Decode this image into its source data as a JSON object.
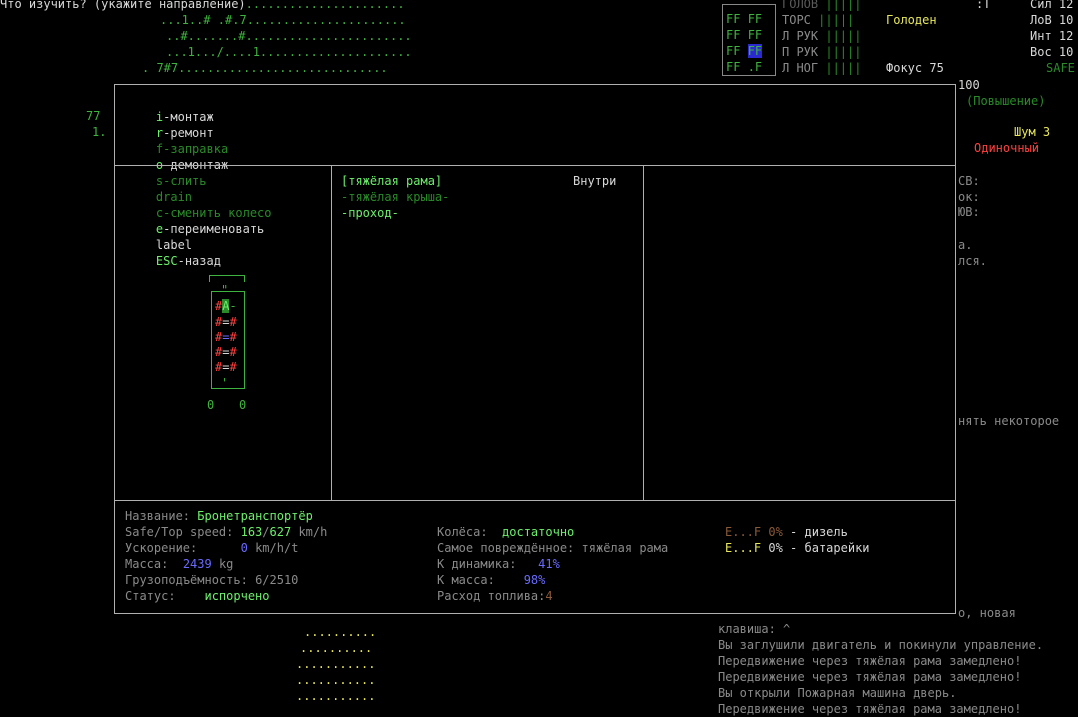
{
  "top_prompt": "Что изучить? (укажите направление)",
  "top_prompt_dots": "......................",
  "map_rows": [
    "...1..# .#.7......................",
    "..#.......#.......................",
    "...1.../....1.....................",
    ". 7#7............................."
  ],
  "left_numbers": [
    "77",
    "1."
  ],
  "body_status": {
    "parts": [
      {
        "label": "ГОЛОВ",
        "bar": "|||||"
      },
      {
        "label": "ТОРС",
        "bar": "|||||"
      },
      {
        "label": "Л РУК",
        "bar": "|||||"
      },
      {
        "label": "П РУК",
        "bar": "|||||"
      },
      {
        "label": "Л НОГ",
        "bar": "|||||"
      }
    ],
    "ff_cells": [
      [
        "FF",
        "FF"
      ],
      [
        "FF",
        "FF"
      ],
      [
        "FF",
        "FF"
      ],
      [
        "FF",
        ".F"
      ]
    ],
    "hunger": "Голоден",
    "focus_label": "Фокус",
    "focus_value": "75",
    "colon_t": ":T"
  },
  "stats": [
    {
      "label": "Сил",
      "value": "12"
    },
    {
      "label": "ЛоВ",
      "value": "10"
    },
    {
      "label": "Инт",
      "value": "12"
    },
    {
      "label": "Вос",
      "value": "10"
    }
  ],
  "safe_label": "SAFE",
  "right_panel": {
    "level": "100",
    "raise": "(Повышение)",
    "noise": "Шум 3",
    "mode": "Одиночный",
    "dirs": [
      "СВ:",
      "ок:",
      "ЮВ:"
    ],
    "frag1": "а.",
    "frag2": "лся.",
    "frag3": "нять некоторое",
    "frag4": "о, новая"
  },
  "commands": [
    {
      "key": "i",
      "text": "-монтаж"
    },
    {
      "key": "r",
      "text": "-ремонт"
    },
    {
      "key": "f",
      "text": "-заправка",
      "dim": true
    },
    {
      "key": "o",
      "text": "-демонтаж"
    },
    {
      "key": "s",
      "text": "-слить",
      "dim": true
    },
    {
      "key": "",
      "text": "drain",
      "dim": true
    },
    {
      "key": "c",
      "text": "-сменить колесо",
      "dim": true
    },
    {
      "key": "e",
      "text": "-переименовать"
    },
    {
      "key": "",
      "text": "label"
    },
    {
      "key": "ESC",
      "text": "-назад"
    }
  ],
  "parts_list": {
    "header": "[тяжёлая рама]",
    "location": "Внутри",
    "items": [
      "-тяжёлая крыша-",
      "-проход-"
    ]
  },
  "vehicle_counts": [
    "0",
    "0"
  ],
  "info": {
    "name_label": "Название:",
    "name_value": "Бронетранспортёр",
    "speed_label": "Safe/Top speed:",
    "speed_safe": "163",
    "speed_top": "627",
    "speed_unit": "km/h",
    "accel_label": "Ускорение:",
    "accel_value": "0",
    "accel_unit": "km/h/t",
    "mass_label": "Масса:",
    "mass_value": "2439",
    "mass_unit": "kg",
    "cargo_label": "Грузоподъёмность:",
    "cargo_value": "6/2510",
    "status_label": "Статус:",
    "status_value": "испорчено",
    "wheels_label": "Колёса:",
    "wheels_value": "достаточно",
    "damaged_label": "Самое повреждённое:",
    "damaged_value": "тяжёлая рама",
    "k_dyn_label": "К динамика:",
    "k_dyn_value": "41%",
    "k_mass_label": "К масса:",
    "k_mass_value": "98%",
    "fuel_label": "Расход топлива:",
    "fuel_value": "4",
    "fuel1_gauge": "E...F",
    "fuel1_pct": "0%",
    "fuel1_name": "- дизель",
    "fuel2_gauge": "E...F",
    "fuel2_pct": "0%",
    "fuel2_name": "- батарейки"
  },
  "bottom_map_rows": [
    "..........",
    "..........",
    "...........",
    "...........",
    "..........."
  ],
  "messages": [
    "клавиша: ^",
    "Вы заглушили двигатель и покинули управление.",
    "Передвижение через тяжёлая рама замедлено!",
    "Передвижение через тяжёлая рама замедлено!",
    "Вы открыли Пожарная машина дверь.",
    "Передвижение через тяжёлая рама замедлено!"
  ]
}
